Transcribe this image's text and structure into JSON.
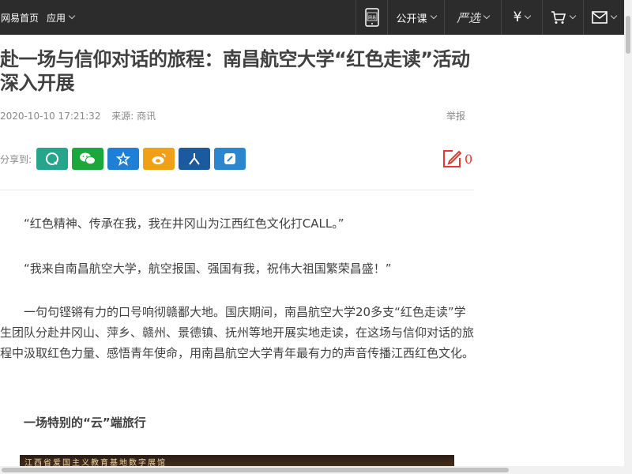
{
  "topbar": {
    "home": "网易首页",
    "apps": "应用",
    "phone_badge": "网易",
    "open_course": "公开课",
    "yanxuan": "严选",
    "yen": "¥"
  },
  "article": {
    "title": "赴一场与信仰对话的旅程：南昌航空大学“红色走读”活动深入开展",
    "date": "2020-10-10 17:21:32",
    "source": "来源: 商讯",
    "report": "举报",
    "share_label": "分享到:",
    "comment_count": "0",
    "paragraphs": [
      "“红色精神、传承在我，我在井冈山为江西红色文化打CALL。”",
      "“我来自南昌航空大学，航空报国、强国有我，祝伟大祖国繁荣昌盛！”",
      "一句句铿锵有力的口号响彻赣鄱大地。国庆期间，南昌航空大学20多支“红色走读”学生团队分赴井冈山、萍乡、赣州、景德镇、抚州等地开展实地走读，在这场与信仰对话的旅程中汲取红色力量、感悟青年使命，用南昌航空大学青年最有力的声音传播江西红色文化。",
      "一场特别的“云”端旅行"
    ],
    "figure_caption": "江西省爱国主义教育基地数字展馆"
  },
  "colors": {
    "topbar_bg": "#2c2c2c",
    "share_colors": [
      "#24a58c",
      "#1aa83a",
      "#1e7fd6",
      "#f0a018",
      "#1a5a9e",
      "#2b86d0"
    ],
    "comment_red": "#e53935"
  },
  "icons": [
    "chevron-down-icon",
    "phone-icon",
    "cart-icon",
    "mail-icon",
    "qzone-icon",
    "wechat-icon",
    "favorite-star-icon",
    "weibo-icon",
    "renren-icon",
    "yixin-icon",
    "comment-edit-icon"
  ]
}
